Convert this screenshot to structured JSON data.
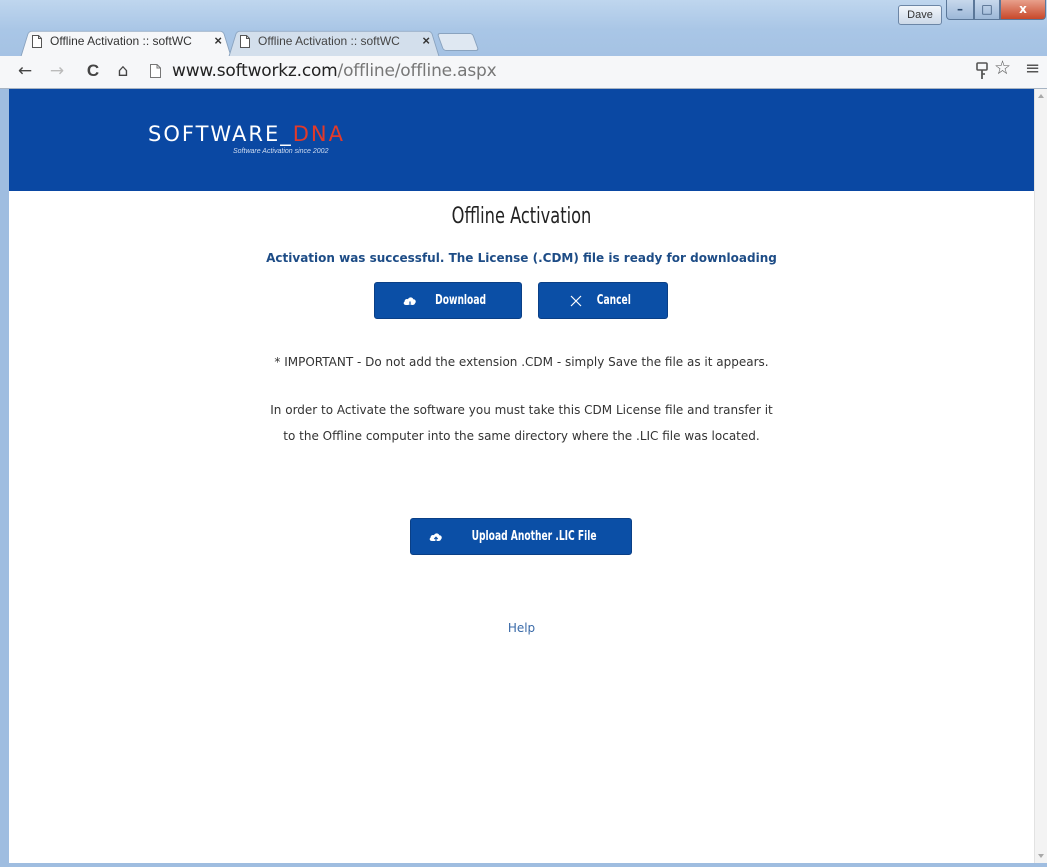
{
  "browser": {
    "tabs": [
      {
        "label": "Offline Activation :: softWC",
        "close": "×"
      },
      {
        "label": "Offline Activation :: softWC",
        "close": "×"
      }
    ],
    "user": "Dave",
    "window_buttons": {
      "minimize": "–",
      "maximize": "□",
      "close": "x"
    },
    "url_host": "www.softworkz.com",
    "url_path": "/offline/offline.aspx",
    "nav": {
      "back": "←",
      "forward": "→",
      "reload": "C",
      "home": "⌂"
    },
    "toolbar_icons": {
      "key": "key-icon",
      "star": "☆",
      "menu": "≡"
    }
  },
  "header": {
    "logo_main": "SOFTWARE_",
    "logo_dna": "DNA",
    "logo_tagline": "Software Activation since 2002",
    "background": "#0a48a3"
  },
  "main": {
    "title": "Offline Activation",
    "success_message": "Activation was successful. The License (.CDM) file is ready for downloading",
    "download_label": "Download",
    "cancel_label": "Cancel",
    "important_note": "* IMPORTANT - Do not add the extension .CDM - simply Save the file as it appears.",
    "instruction_line1": "In order to Activate the software you must take this CDM License file and transfer it",
    "instruction_line2": "to the Offline computer into the same directory where the .LIC file was located.",
    "upload_label": "Upload Another .LIC File",
    "help_label": "Help"
  },
  "colors": {
    "accent": "#0b4fa6",
    "success_text": "#1d4c86",
    "logo_dna": "#e23a2a"
  }
}
